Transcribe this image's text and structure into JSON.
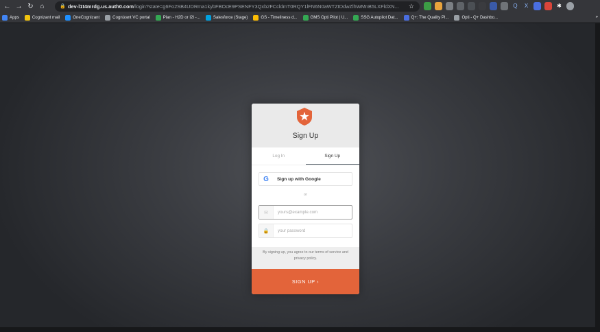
{
  "browser": {
    "url_host": "dev-l1t4mrdg.us.auth0.com",
    "url_path": "/login?state=g6Fo2SB4UDRma1kybFBOcE9PSENFY3Qxb2FCcldmT0RQY1lFN6N0aWTZIDdwZlhWMnB5LXFldXN...",
    "bookmarks": [
      {
        "label": "Apps",
        "color": "#4285f4"
      },
      {
        "label": "Cognizant mail",
        "color": "#f1c40f"
      },
      {
        "label": "OneCognizant",
        "color": "#1e90ff"
      },
      {
        "label": "Cognizant VC portal",
        "color": "#9aa0a6"
      },
      {
        "label": "Plan - H2D or I2I -...",
        "color": "#34a853"
      },
      {
        "label": "Salesforce (Stage)",
        "color": "#00a1e0"
      },
      {
        "label": "GS - Timeliness d...",
        "color": "#fbbc04"
      },
      {
        "label": "GMS Opti Pilot | U...",
        "color": "#34a853"
      },
      {
        "label": "SSG Autopilot Dat...",
        "color": "#34a853"
      },
      {
        "label": "Q+: The Quality Pl...",
        "color": "#4a6ee0"
      },
      {
        "label": "Opti - Q+ Dashbo...",
        "color": "#9aa0a6"
      }
    ],
    "more_label": "»"
  },
  "auth": {
    "title": "Sign Up",
    "tabs": [
      "Log In",
      "Sign Up"
    ],
    "active_tab": "Sign Up",
    "social_label": "Sign up with Google",
    "social_icon_letter": "G",
    "divider": "or",
    "email_placeholder": "yours@example.com",
    "password_placeholder": "your password",
    "terms": "By signing up, you agree to our terms of service and privacy policy.",
    "submit_label": "SIGN UP ›",
    "accent_color": "#e3643a",
    "logo_color": "#e3643a"
  }
}
